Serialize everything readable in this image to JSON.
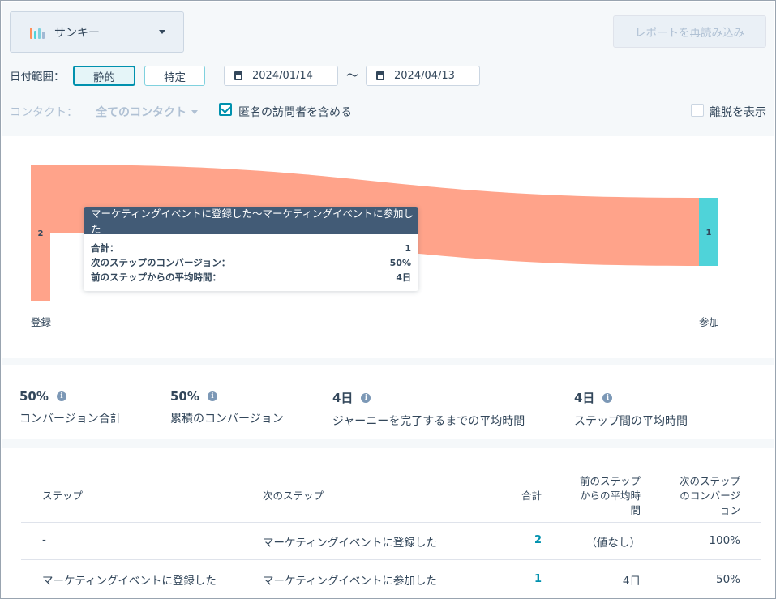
{
  "controls": {
    "chart_type": {
      "label": "サンキー",
      "icon": "sankey-chart-icon",
      "colors": [
        "#ff8f59",
        "#51d3d9",
        "#7fd1de",
        "#a2b9d4"
      ]
    },
    "reload_button": "レポートを再読み込み",
    "date_range": {
      "label": "日付範囲：",
      "mode_static": "静的",
      "mode_custom": "特定",
      "start": "2024/01/14",
      "separator": "〜",
      "end": "2024/04/13"
    },
    "contact": {
      "label": "コンタクト：",
      "value": "全てのコンタクト",
      "include_anonymous": {
        "label": "匿名の訪問者を含める",
        "checked": true
      }
    },
    "show_dropoff": {
      "label": "離脱を表示",
      "checked": false
    }
  },
  "chart_data": {
    "type": "sankey",
    "nodes": [
      {
        "name": "登録",
        "value": 2,
        "color": "#ffa38a"
      },
      {
        "name": "参加",
        "value": 1,
        "color": "#4fd3d9"
      }
    ],
    "links": [
      {
        "source": "登録",
        "target": "参加",
        "value": 1,
        "color": "#ffa38a"
      }
    ],
    "dropoff": {
      "source": "登録",
      "value": 1
    },
    "tooltip": {
      "title": "マーケティングイベントに登録した〜マーケティングイベントに参加した",
      "rows": [
        {
          "label": "合計：",
          "value": "1"
        },
        {
          "label": "次のステップのコンバージョン：",
          "value": "50%"
        },
        {
          "label": "前のステップからの平均時間：",
          "value": "4日"
        }
      ]
    }
  },
  "stats": [
    {
      "value": "50%",
      "label": "コンバージョン合計"
    },
    {
      "value": "50%",
      "label": "累積のコンバージョン"
    },
    {
      "value": "4日",
      "label": "ジャーニーを完了するまでの平均時間"
    },
    {
      "value": "4日",
      "label": "ステップ間の平均時間"
    }
  ],
  "table": {
    "headers": {
      "step": "ステップ",
      "next_step": "次のステップ",
      "total": "合計",
      "avg_time_lines": [
        "前のステップ",
        "からの平均時",
        "間"
      ],
      "conversion_lines": [
        "次のステップ",
        "のコンバージ",
        "ョン"
      ]
    },
    "rows": [
      {
        "step": "-",
        "next_step": "マーケティングイベントに登録した",
        "total": "2",
        "avg_time": "（値なし）",
        "conversion": "100%"
      },
      {
        "step": "マーケティングイベントに登録した",
        "next_step": "マーケティングイベントに参加した",
        "total": "1",
        "avg_time": "4日",
        "conversion": "50%"
      }
    ]
  }
}
